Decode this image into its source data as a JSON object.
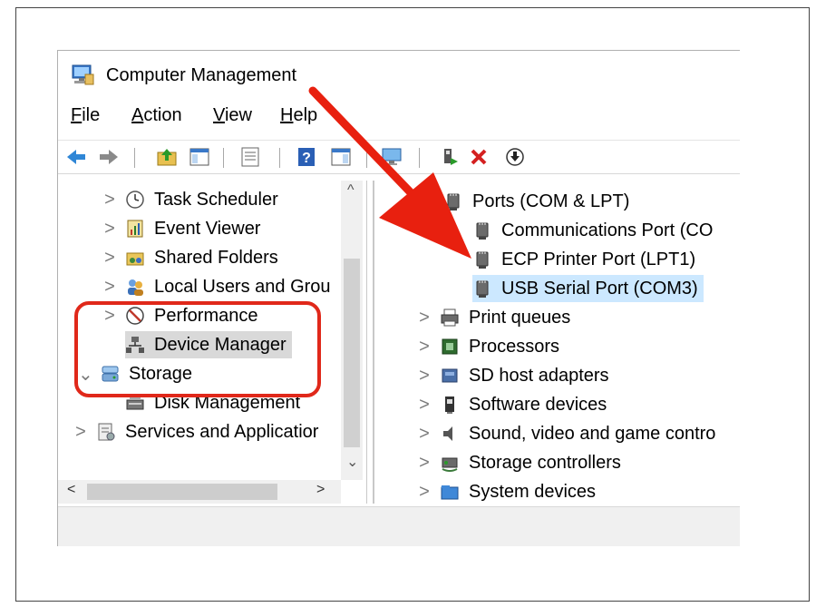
{
  "window": {
    "title": "Computer Management",
    "title_icon": "computer-management-icon"
  },
  "menu": [
    {
      "id": "file",
      "label": "File",
      "mnemonic": "F",
      "rest": "ile"
    },
    {
      "id": "action",
      "label": "Action",
      "mnemonic": "A",
      "rest": "ction"
    },
    {
      "id": "view",
      "label": "View",
      "mnemonic": "V",
      "rest": "iew"
    },
    {
      "id": "help",
      "label": "Help",
      "mnemonic": "H",
      "rest": "elp"
    }
  ],
  "toolbar": [
    "back-icon",
    "forward-icon",
    "up-folder-icon",
    "show-hide-tree-icon",
    "properties-icon",
    "help-icon",
    "action-pane-icon",
    "monitor-icon",
    "enable-device-icon",
    "uninstall-icon",
    "update-driver-icon"
  ],
  "left_tree": {
    "items": [
      {
        "label": "Task Scheduler",
        "icon": "task-scheduler-icon",
        "chevron": ">"
      },
      {
        "label": "Event Viewer",
        "icon": "event-viewer-icon",
        "chevron": ">"
      },
      {
        "label": "Shared Folders",
        "icon": "shared-folders-icon",
        "chevron": ">"
      },
      {
        "label": "Local Users and Grou",
        "icon": "local-users-icon",
        "chevron": ">"
      },
      {
        "label": "Performance",
        "icon": "performance-icon",
        "chevron": ">"
      },
      {
        "label": "Device Manager",
        "icon": "device-manager-icon",
        "chevron": ""
      },
      {
        "label": "Storage",
        "icon": "storage-icon",
        "chevron": "⌄"
      },
      {
        "label": "Disk Management",
        "icon": "disk-management-icon",
        "chevron": ""
      },
      {
        "label": "Services and Applicatior",
        "icon": "services-icon",
        "chevron": ">"
      }
    ],
    "scroll_up": "^",
    "scroll_down": "⌄",
    "scroll_left": "<",
    "scroll_right": ">"
  },
  "right_tree": {
    "items": [
      {
        "label": "Ports (COM & LPT)",
        "icon": "port-icon",
        "chevron": ""
      },
      {
        "label": "Communications Port (CO",
        "icon": "port-icon",
        "chevron": ""
      },
      {
        "label": "ECP Printer Port (LPT1)",
        "icon": "port-icon",
        "chevron": ""
      },
      {
        "label": "USB Serial Port (COM3)",
        "icon": "port-icon",
        "chevron": ""
      },
      {
        "label": "Print queues",
        "icon": "printer-icon",
        "chevron": ">"
      },
      {
        "label": "Processors",
        "icon": "processor-icon",
        "chevron": ">"
      },
      {
        "label": "SD host adapters",
        "icon": "sd-adapter-icon",
        "chevron": ">"
      },
      {
        "label": "Software devices",
        "icon": "software-device-icon",
        "chevron": ">"
      },
      {
        "label": "Sound, video and game contro",
        "icon": "sound-icon",
        "chevron": ">"
      },
      {
        "label": "Storage controllers",
        "icon": "storage-controller-icon",
        "chevron": ">"
      },
      {
        "label": "System devices",
        "icon": "system-devices-icon",
        "chevron": ">"
      }
    ]
  },
  "colors": {
    "annotation_red": "#e0281a",
    "selection_blue": "#cce8ff",
    "selection_gray": "#d9d9d9"
  }
}
